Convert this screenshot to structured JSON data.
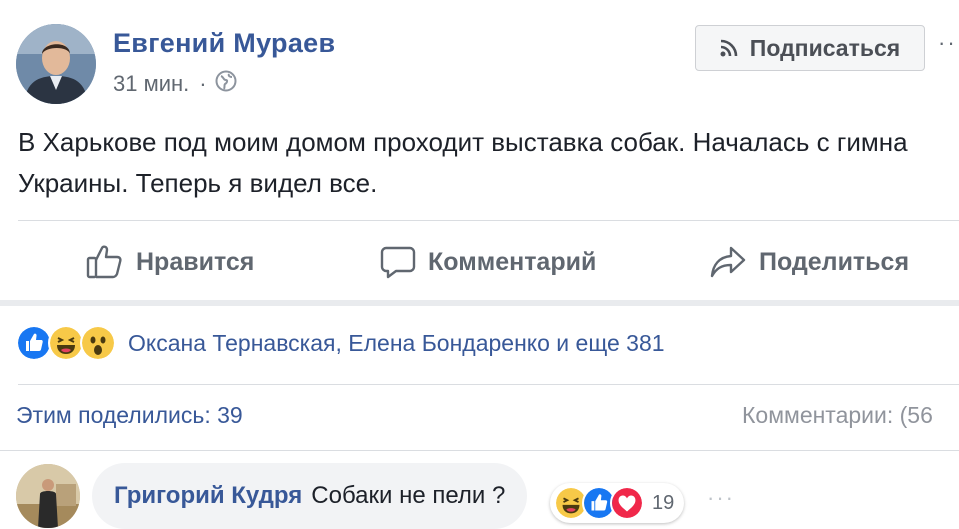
{
  "post": {
    "author": "Евгений Мураев",
    "time": "31 мин.",
    "separator": "·",
    "privacy_icon": "globe-icon",
    "subscribe_label": "Подписаться",
    "more": "···",
    "text": "В Харькове под моим домом проходит выставка собак. Началась с гимна Украины. Теперь я видел все."
  },
  "actions": {
    "like": "Нравится",
    "comment": "Комментарий",
    "share": "Поделиться"
  },
  "reactions": {
    "icons": [
      "like-icon",
      "haha-icon",
      "wow-icon"
    ],
    "names": "Оксана Тернавская, Елена Бондаренко и еще 381"
  },
  "stats": {
    "shares": "Этим поделились: 39",
    "comments": "Комментарии: (56"
  },
  "comment": {
    "author": "Григорий Кудря",
    "text": "Собаки не пели ?",
    "reaction_icons": [
      "haha-icon",
      "like-icon",
      "love-icon"
    ],
    "reaction_count": "19",
    "more": "···"
  },
  "colors": {
    "link": "#385898",
    "text": "#1d2129",
    "muted": "#606770",
    "like_blue": "#1877f2",
    "love_red": "#f0284a",
    "haha_yellow": "#f7c948"
  }
}
